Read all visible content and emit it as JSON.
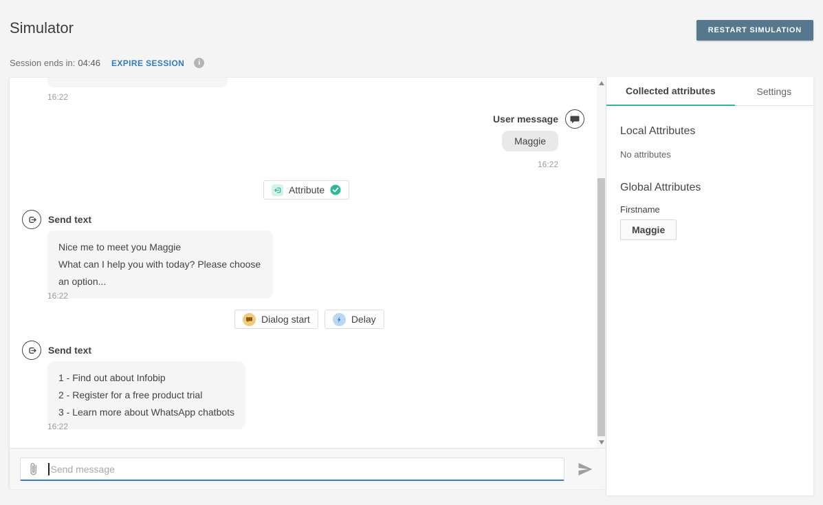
{
  "header": {
    "title": "Simulator",
    "restart_button": "RESTART SIMULATION"
  },
  "session": {
    "label": "Session ends in:",
    "time_remaining": "04:46",
    "expire_button": "EXPIRE SESSION"
  },
  "chat": {
    "previous_message_timestamp": "16:22",
    "user_message": {
      "label": "User message",
      "text": "Maggie",
      "timestamp": "16:22"
    },
    "attribute_chip": {
      "label": "Attribute",
      "status": "success"
    },
    "bot_message_1": {
      "label": "Send text",
      "lines": [
        "Nice me to meet you Maggie",
        "What can I help you with today? Please choose an option..."
      ],
      "timestamp": "16:22"
    },
    "dialog_start_chip": {
      "label": "Dialog start"
    },
    "delay_chip": {
      "label": "Delay"
    },
    "bot_message_2": {
      "label": "Send text",
      "lines": [
        "1 - Find out about Infobip",
        "2 - Register for a free product trial",
        "3 - Learn more about WhatsApp chatbots"
      ],
      "timestamp": "16:22"
    }
  },
  "composer": {
    "placeholder": "Send message"
  },
  "attributes_panel": {
    "tabs": [
      "Collected attributes",
      "Settings"
    ],
    "local": {
      "heading": "Local Attributes",
      "empty_text": "No attributes"
    },
    "global": {
      "heading": "Global Attributes",
      "attributes": [
        {
          "name": "Firstname",
          "value": "Maggie"
        }
      ]
    }
  },
  "icons": {
    "user_message": "chat-bubble-icon",
    "send_text": "logout-arrow-icon",
    "attribute": "import-arrow-icon",
    "attribute_status": "check-circle-icon",
    "dialog_start": "chat-bubble-icon",
    "delay": "lightning-bolt-icon",
    "attach": "paperclip-icon",
    "send": "paper-plane-icon",
    "session_info": "info-circle-icon"
  },
  "colors": {
    "accent_teal": "#2fb79b",
    "link_blue": "#3379bd",
    "restart_button_bg": "#55788f",
    "input_focus_blue": "#3b7dc4",
    "dialog_start_amber": "#f3c97d",
    "delay_blue": "#3a7bc8"
  }
}
